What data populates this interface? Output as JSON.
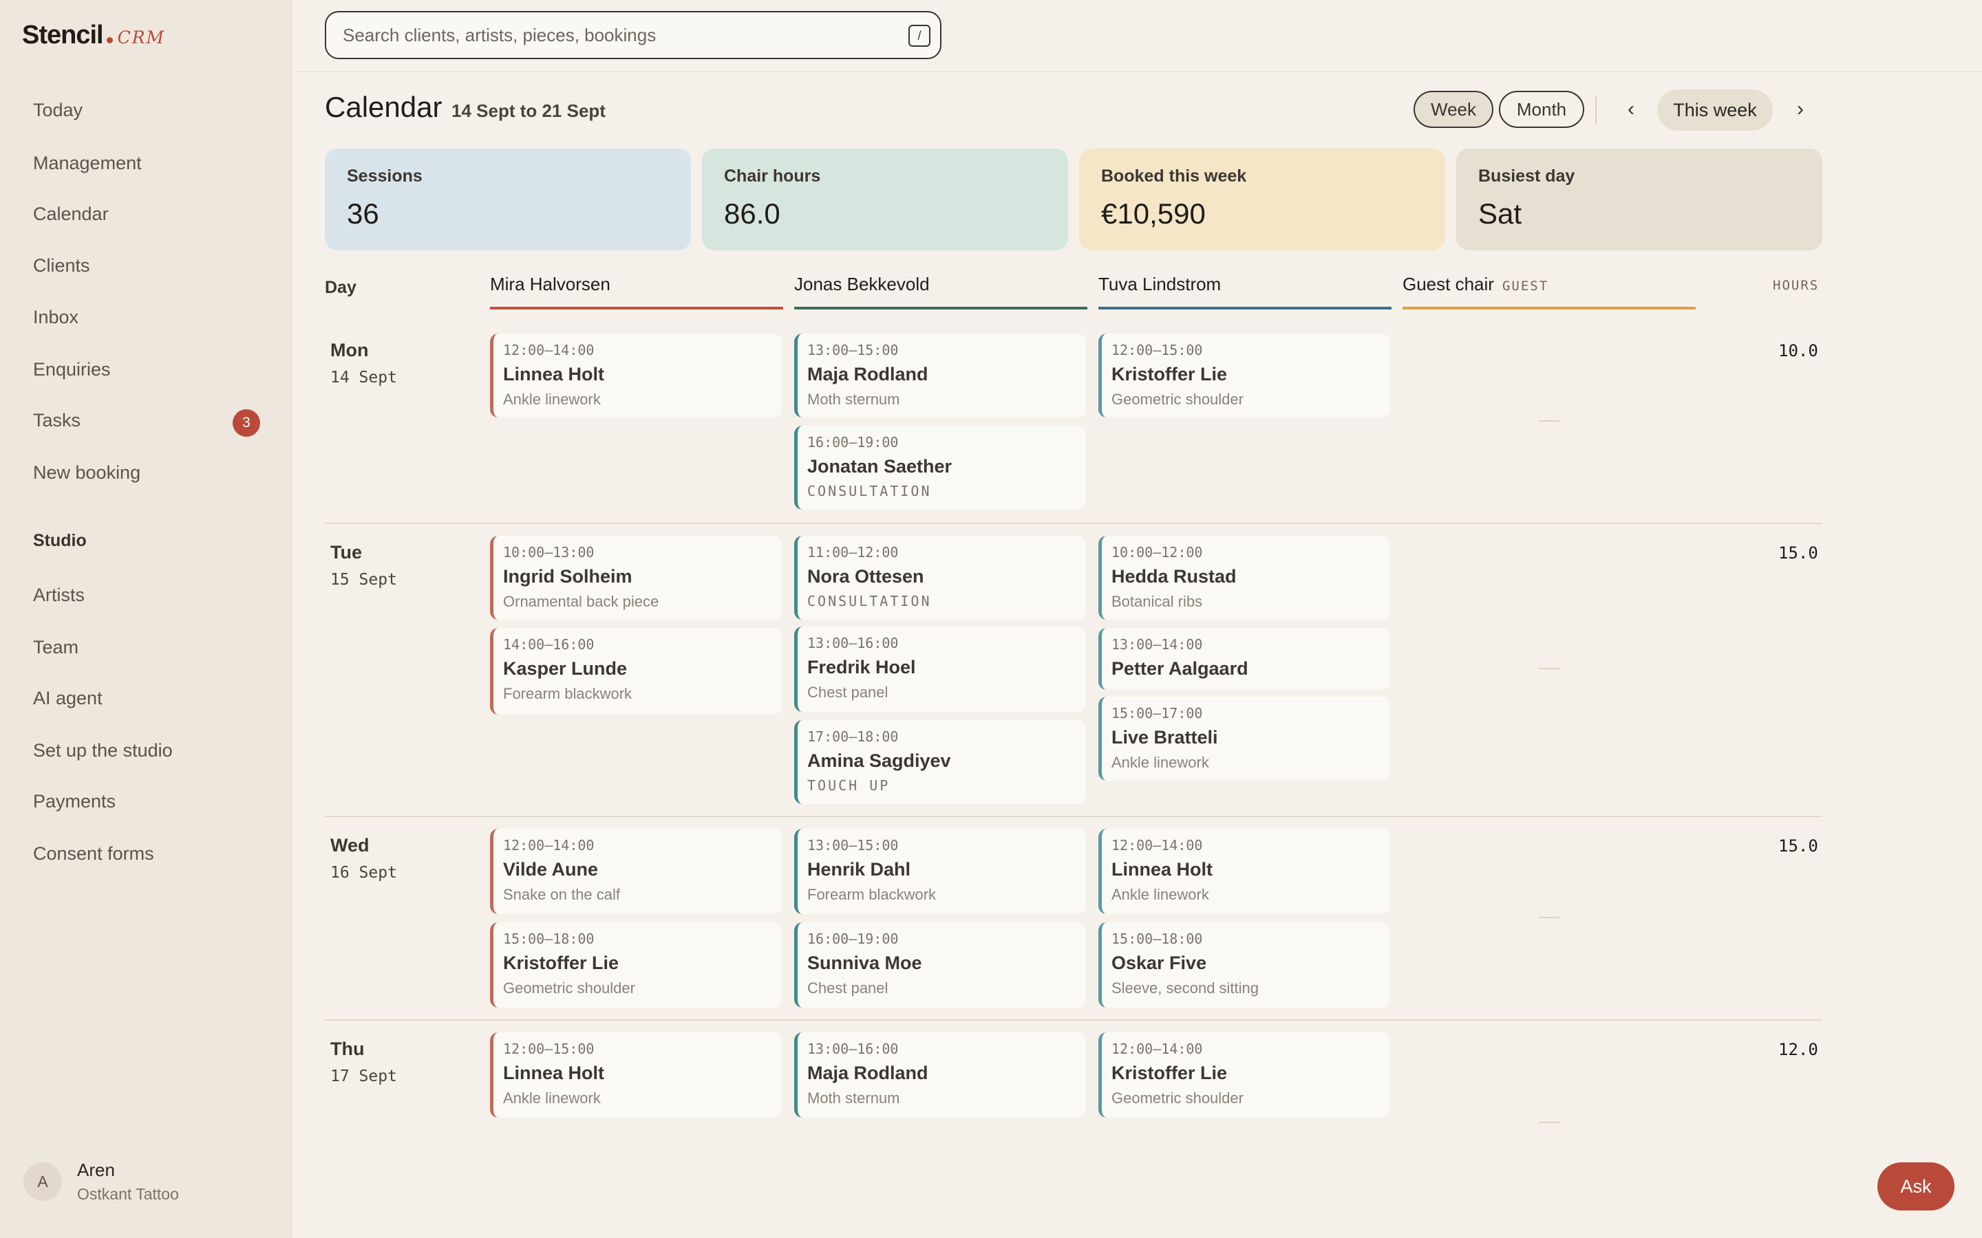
{
  "app": {
    "name": "Stencil",
    "suffix": "CRM"
  },
  "sidebar": {
    "items": [
      {
        "label": "Today"
      },
      {
        "label": "Management"
      },
      {
        "label": "Calendar"
      },
      {
        "label": "Clients"
      },
      {
        "label": "Inbox"
      },
      {
        "label": "Enquiries"
      },
      {
        "label": "Tasks",
        "badge": "3"
      },
      {
        "label": "New booking"
      }
    ],
    "section_label": "Studio",
    "studio_items": [
      {
        "label": "Artists"
      },
      {
        "label": "Team"
      },
      {
        "label": "AI agent"
      },
      {
        "label": "Set up the studio"
      },
      {
        "label": "Payments"
      },
      {
        "label": "Consent forms"
      }
    ],
    "user": {
      "initial": "A",
      "name": "Aren",
      "studio": "Ostkant Tattoo"
    }
  },
  "search": {
    "placeholder": "Search clients, artists, pieces, bookings",
    "shortcut": "/"
  },
  "header": {
    "title": "Calendar",
    "range": "14 Sept to 21 Sept",
    "view_week": "Week",
    "view_month": "Month",
    "active_view": "Week",
    "prev": "‹",
    "next": "›",
    "this_week": "This week"
  },
  "stats": [
    {
      "label": "Sessions",
      "value": "36",
      "color": "#d8e4ea"
    },
    {
      "label": "Chair hours",
      "value": "86.0",
      "color": "#d6e6df"
    },
    {
      "label": "Booked this week",
      "value": "€10,590",
      "color": "#f5e6c8"
    },
    {
      "label": "Busiest day",
      "value": "Sat",
      "color": "#e6dfd2"
    }
  ],
  "calendar": {
    "day_header": "Day",
    "hours_header": "HOURS",
    "artists": [
      {
        "name": "Mira Halvorsen",
        "color": "#c0503f"
      },
      {
        "name": "Jonas Bekkevold",
        "color": "#3a6e58"
      },
      {
        "name": "Tuva Lindstrom",
        "color": "#3c6f94"
      },
      {
        "name": "Guest chair",
        "tag": "GUEST",
        "color": "#e0a040"
      }
    ],
    "days": [
      {
        "name": "Mon",
        "date": "14 Sept",
        "hours": "10.0",
        "bookings": [
          [
            {
              "time": "12:00–14:00",
              "client": "Linnea Holt",
              "piece": "Ankle linework"
            }
          ],
          [
            {
              "time": "13:00–15:00",
              "client": "Maja Rodland",
              "piece": "Moth sternum"
            },
            {
              "time": "16:00–19:00",
              "client": "Jonatan Saether",
              "piece": "CONSULTATION"
            }
          ],
          [
            {
              "time": "12:00–15:00",
              "client": "Kristoffer Lie",
              "piece": "Geometric shoulder"
            }
          ]
        ]
      },
      {
        "name": "Tue",
        "date": "15 Sept",
        "hours": "15.0",
        "bookings": [
          [
            {
              "time": "10:00–13:00",
              "client": "Ingrid Solheim",
              "piece": "Ornamental back piece"
            },
            {
              "time": "14:00–16:00",
              "client": "Kasper Lunde",
              "piece": "Forearm blackwork"
            }
          ],
          [
            {
              "time": "11:00–12:00",
              "client": "Nora Ottesen",
              "piece": "CONSULTATION"
            },
            {
              "time": "13:00–16:00",
              "client": "Fredrik Hoel",
              "piece": "Chest panel"
            },
            {
              "time": "17:00–18:00",
              "client": "Amina Sagdiyev",
              "piece": "TOUCH UP"
            }
          ],
          [
            {
              "time": "10:00–12:00",
              "client": "Hedda Rustad",
              "piece": "Botanical ribs"
            },
            {
              "time": "13:00–14:00",
              "client": "Petter Aalgaard",
              "piece": ""
            },
            {
              "time": "15:00–17:00",
              "client": "Live Bratteli",
              "piece": "Ankle linework"
            }
          ]
        ]
      },
      {
        "name": "Wed",
        "date": "16 Sept",
        "hours": "15.0",
        "bookings": [
          [
            {
              "time": "12:00–14:00",
              "client": "Vilde Aune",
              "piece": "Snake on the calf"
            },
            {
              "time": "15:00–18:00",
              "client": "Kristoffer Lie",
              "piece": "Geometric shoulder"
            }
          ],
          [
            {
              "time": "13:00–15:00",
              "client": "Henrik Dahl",
              "piece": "Forearm blackwork"
            },
            {
              "time": "16:00–19:00",
              "client": "Sunniva Moe",
              "piece": "Chest panel"
            }
          ],
          [
            {
              "time": "12:00–14:00",
              "client": "Linnea Holt",
              "piece": "Ankle linework"
            },
            {
              "time": "15:00–18:00",
              "client": "Oskar Five",
              "piece": "Sleeve, second sitting"
            }
          ]
        ]
      },
      {
        "name": "Thu",
        "date": "17 Sept",
        "hours": "12.0",
        "bookings": [
          [
            {
              "time": "12:00–15:00",
              "client": "Linnea Holt",
              "piece": "Ankle linework"
            }
          ],
          [
            {
              "time": "13:00–16:00",
              "client": "Maja Rodland",
              "piece": "Moth sternum"
            }
          ],
          [
            {
              "time": "12:00–14:00",
              "client": "Kristoffer Lie",
              "piece": "Geometric shoulder"
            }
          ]
        ]
      }
    ]
  },
  "ask_label": "Ask"
}
